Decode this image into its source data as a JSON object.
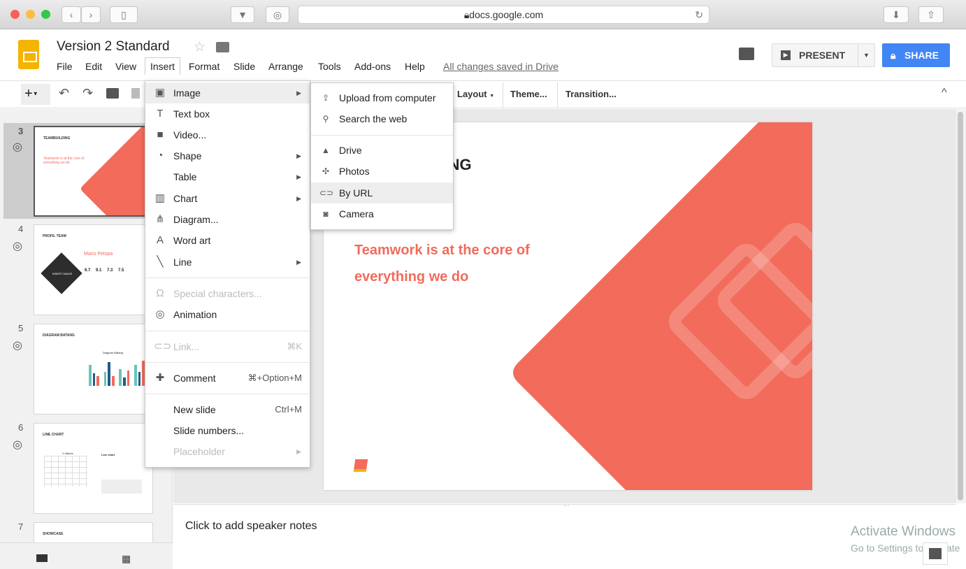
{
  "browser": {
    "url": "docs.google.com"
  },
  "app": {
    "title": "Version 2 Standard",
    "saved_status": "All changes saved in Drive",
    "present_label": "PRESENT",
    "share_label": "SHARE",
    "brand_color": "#f4b400",
    "share_color": "#4285f4"
  },
  "menubar": [
    "File",
    "Edit",
    "View",
    "Insert",
    "Format",
    "Slide",
    "Arrange",
    "Tools",
    "Add-ons",
    "Help"
  ],
  "toolbar": {
    "layout": "Layout",
    "theme": "Theme...",
    "transition": "Transition..."
  },
  "filmstrip": [
    {
      "num": "3",
      "title": "TEAMBUILDING",
      "selected": true
    },
    {
      "num": "4",
      "title": "PROFIL TEAM",
      "name": "Mario Pelopa",
      "stats": [
        "6.7",
        "9.1",
        "7.3",
        "7.5"
      ],
      "placeholder": "INSERT IMAGE"
    },
    {
      "num": "5",
      "title": "DIAGRAM BATANG",
      "chart_title": "Diagram Batang"
    },
    {
      "num": "6",
      "title": "LINE CHART",
      "chart_title": "Y-Values",
      "side_title": "Line chart"
    },
    {
      "num": "7",
      "title": "SHOWCASE"
    }
  ],
  "slide": {
    "title": "TEAMBUILDING",
    "quote_mark": "“",
    "quote": "Teamwork is at the core of everything we do",
    "accent": "#f26b5b"
  },
  "notes": {
    "placeholder": "Click to add speaker notes"
  },
  "insert_menu": {
    "items": [
      {
        "label": "Image",
        "icon": "image-icon",
        "submenu": true,
        "highlighted": true
      },
      {
        "label": "Text box",
        "icon": "text-box-icon"
      },
      {
        "label": "Video...",
        "icon": "video-icon"
      },
      {
        "label": "Shape",
        "icon": "shape-icon",
        "submenu": true
      },
      {
        "label": "Table",
        "submenu": true
      },
      {
        "label": "Chart",
        "icon": "chart-icon",
        "submenu": true
      },
      {
        "label": "Diagram...",
        "icon": "diagram-icon"
      },
      {
        "label": "Word art",
        "icon": "word-art-icon"
      },
      {
        "label": "Line",
        "icon": "line-icon",
        "submenu": true
      },
      {
        "label": "Special characters...",
        "icon": "omega-icon",
        "disabled": true
      },
      {
        "label": "Animation",
        "icon": "animation-icon"
      },
      {
        "label": "Link...",
        "icon": "link-icon",
        "shortcut": "⌘K",
        "disabled": true
      },
      {
        "label": "Comment",
        "icon": "comment-icon",
        "shortcut": "⌘+Option+M"
      },
      {
        "label": "New slide",
        "shortcut": "Ctrl+M"
      },
      {
        "label": "Slide numbers..."
      },
      {
        "label": "Placeholder",
        "submenu": true,
        "disabled": true
      }
    ]
  },
  "image_submenu": {
    "items": [
      {
        "label": "Upload from computer",
        "icon": "upload-icon"
      },
      {
        "label": "Search the web",
        "icon": "search-icon"
      },
      {
        "label": "Drive",
        "icon": "drive-icon"
      },
      {
        "label": "Photos",
        "icon": "photos-icon"
      },
      {
        "label": "By URL",
        "icon": "link-icon",
        "highlighted": true
      },
      {
        "label": "Camera",
        "icon": "camera-icon"
      }
    ]
  },
  "watermark": {
    "line1": "Activate Windows",
    "line2": "Go to Settings to activate"
  }
}
